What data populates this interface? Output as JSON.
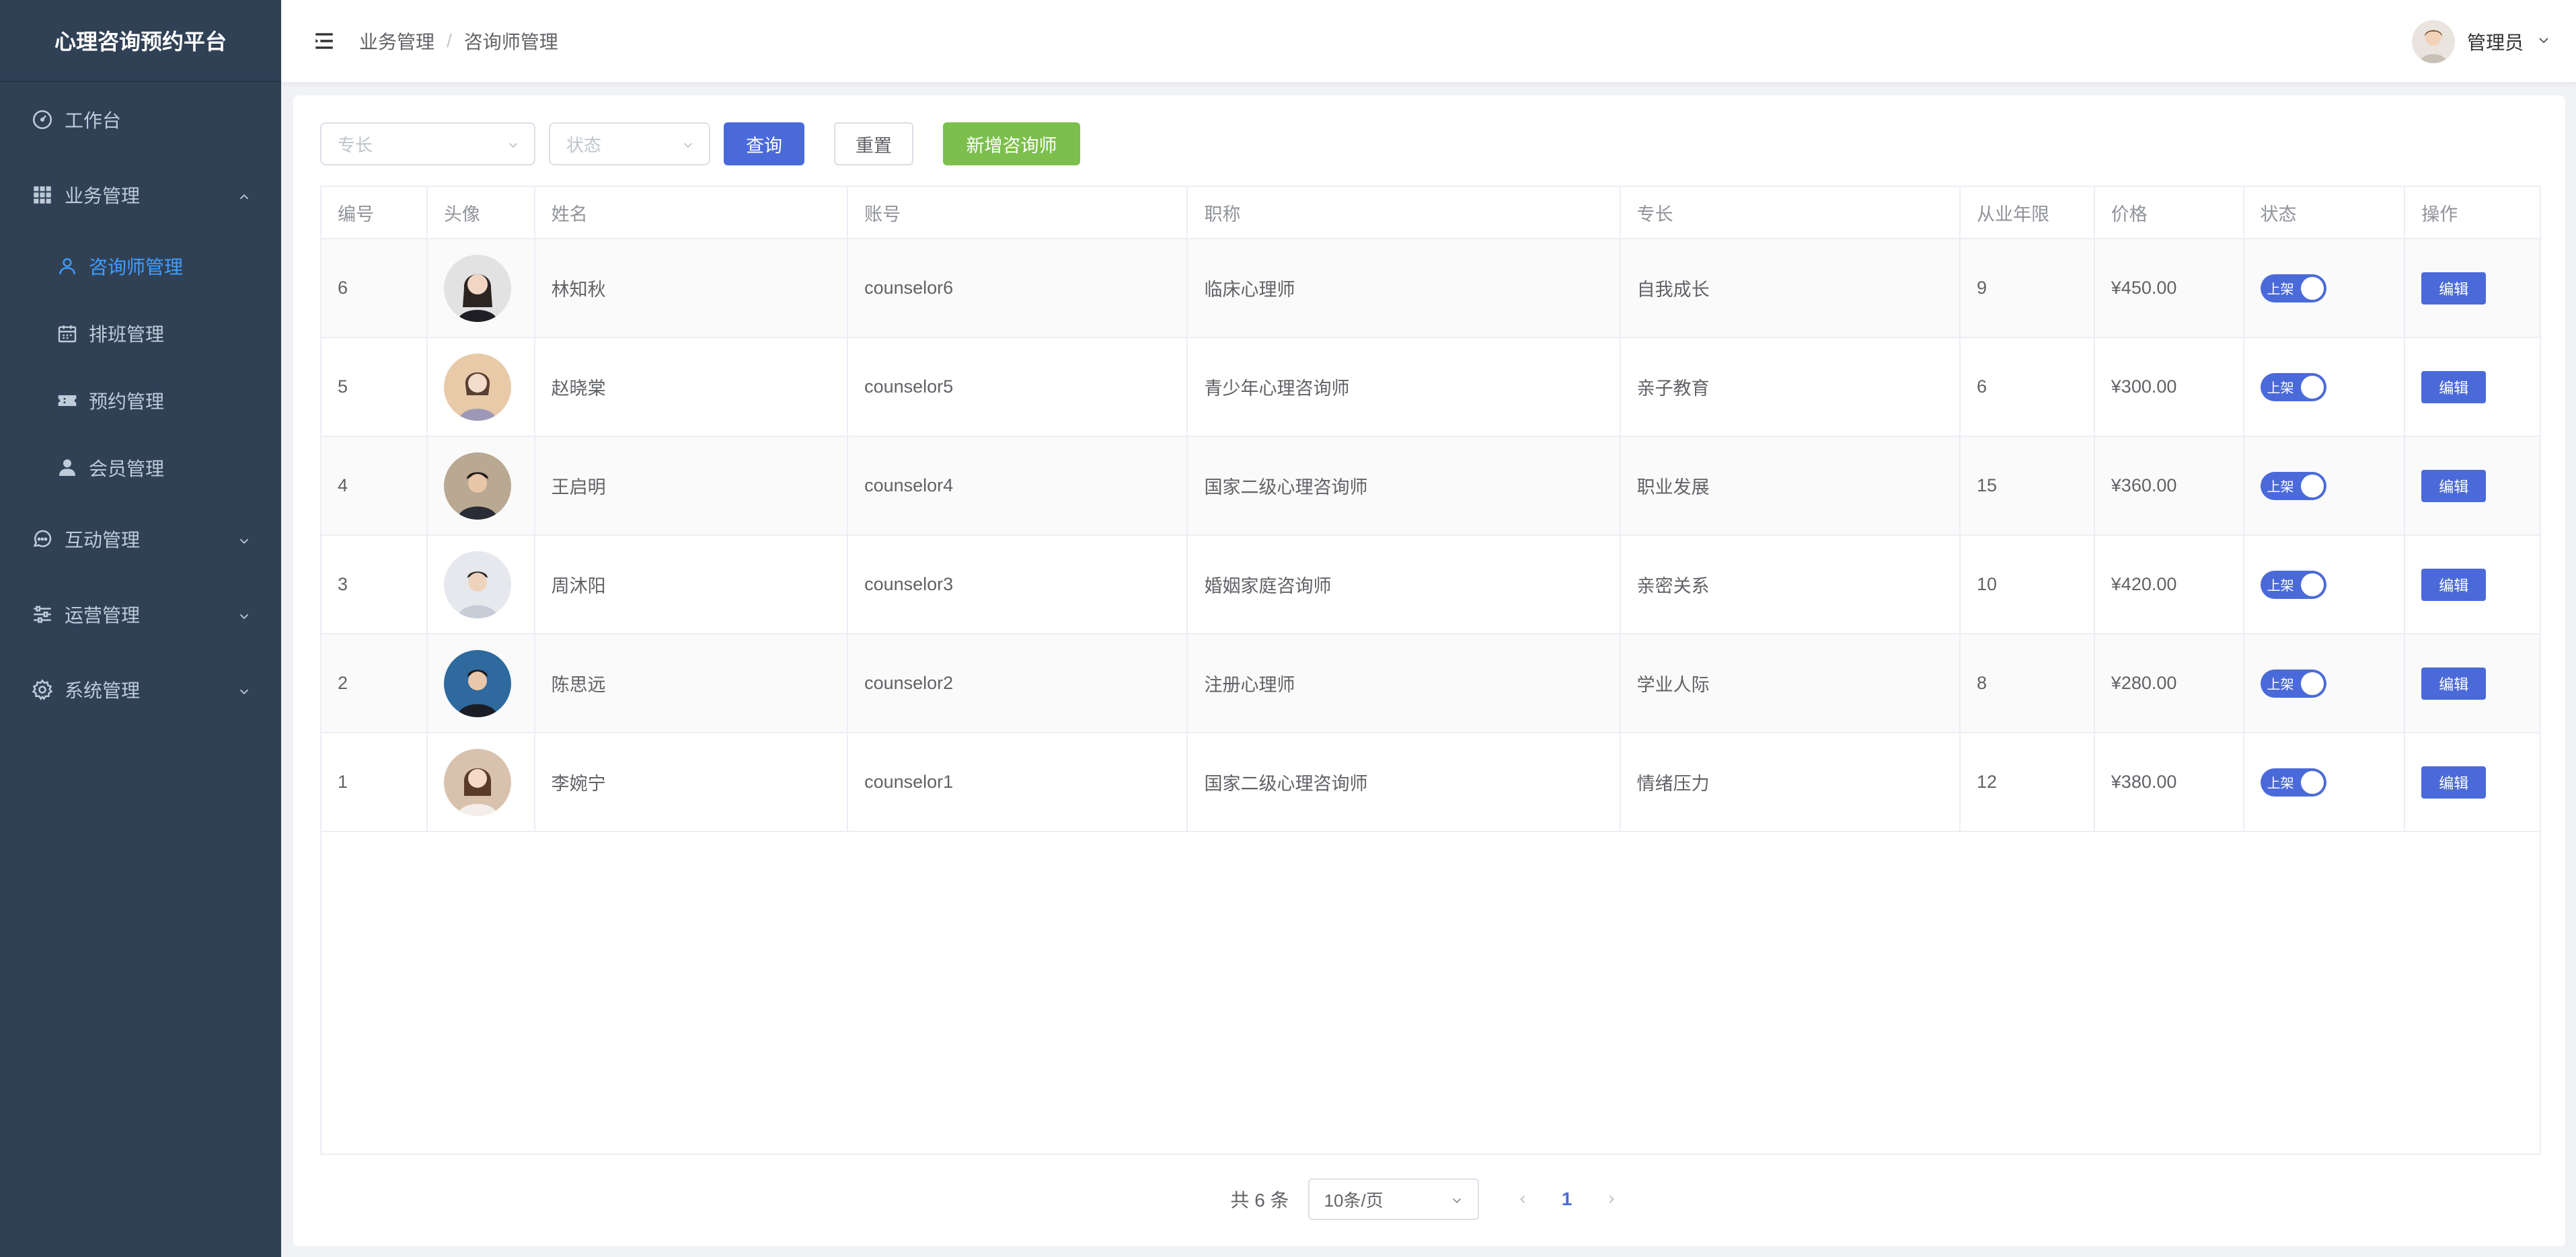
{
  "app": {
    "title": "心理咨询预约平台"
  },
  "sidebar": {
    "items": [
      {
        "label": "工作台",
        "icon": "dashboard-icon"
      },
      {
        "label": "业务管理",
        "icon": "grid-icon",
        "expanded": true,
        "children": [
          {
            "label": "咨询师管理",
            "icon": "user-icon",
            "active": true
          },
          {
            "label": "排班管理",
            "icon": "calendar-icon"
          },
          {
            "label": "预约管理",
            "icon": "ticket-icon"
          },
          {
            "label": "会员管理",
            "icon": "member-icon"
          }
        ]
      },
      {
        "label": "互动管理",
        "icon": "chat-icon"
      },
      {
        "label": "运营管理",
        "icon": "sliders-icon"
      },
      {
        "label": "系统管理",
        "icon": "gear-icon"
      }
    ]
  },
  "header": {
    "breadcrumb": [
      "业务管理",
      "咨询师管理"
    ],
    "separator": "/",
    "user_name": "管理员"
  },
  "filters": {
    "specialty_placeholder": "专长",
    "status_placeholder": "状态",
    "query_label": "查询",
    "reset_label": "重置",
    "add_label": "新增咨询师"
  },
  "table": {
    "columns": [
      "编号",
      "头像",
      "姓名",
      "账号",
      "职称",
      "专长",
      "从业年限",
      "价格",
      "状态",
      "操作"
    ],
    "rows": [
      {
        "id": "6",
        "name": "林知秋",
        "account": "counselor6",
        "title": "临床心理师",
        "specialty": "自我成长",
        "years": "9",
        "price": "¥450.00",
        "status": "上架",
        "action": "编辑"
      },
      {
        "id": "5",
        "name": "赵晓棠",
        "account": "counselor5",
        "title": "青少年心理咨询师",
        "specialty": "亲子教育",
        "years": "6",
        "price": "¥300.00",
        "status": "上架",
        "action": "编辑"
      },
      {
        "id": "4",
        "name": "王启明",
        "account": "counselor4",
        "title": "国家二级心理咨询师",
        "specialty": "职业发展",
        "years": "15",
        "price": "¥360.00",
        "status": "上架",
        "action": "编辑"
      },
      {
        "id": "3",
        "name": "周沐阳",
        "account": "counselor3",
        "title": "婚姻家庭咨询师",
        "specialty": "亲密关系",
        "years": "10",
        "price": "¥420.00",
        "status": "上架",
        "action": "编辑"
      },
      {
        "id": "2",
        "name": "陈思远",
        "account": "counselor2",
        "title": "注册心理师",
        "specialty": "学业人际",
        "years": "8",
        "price": "¥280.00",
        "status": "上架",
        "action": "编辑"
      },
      {
        "id": "1",
        "name": "李婉宁",
        "account": "counselor1",
        "title": "国家二级心理咨询师",
        "specialty": "情绪压力",
        "years": "12",
        "price": "¥380.00",
        "status": "上架",
        "action": "编辑"
      }
    ]
  },
  "pagination": {
    "total_text": "共 6 条",
    "page_size": "10条/页",
    "current_page": "1"
  },
  "colors": {
    "sidebar_bg": "#304156",
    "primary": "#4b6ad9",
    "success": "#7cbf4c",
    "active_menu": "#409eff"
  }
}
